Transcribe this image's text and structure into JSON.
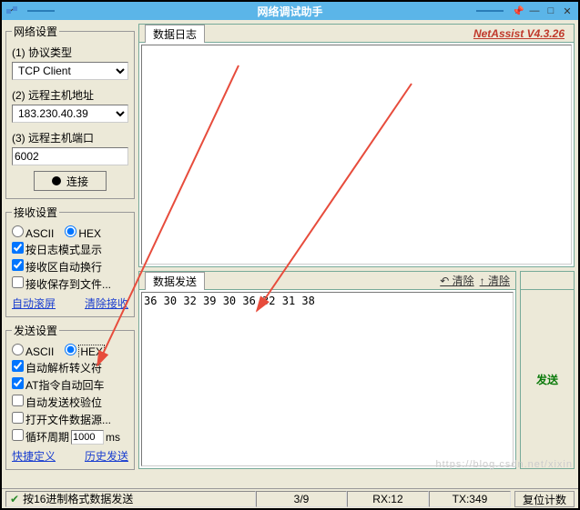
{
  "titlebar": {
    "title": "网络调试助手"
  },
  "version_label": "NetAssist V4.3.26",
  "network": {
    "legend": "网络设置",
    "protocol_label": "(1) 协议类型",
    "protocol_value": "TCP Client",
    "host_label": "(2) 远程主机地址",
    "host_value": "183.230.40.39",
    "port_label": "(3) 远程主机端口",
    "port_value": "6002",
    "connect_label": "连接"
  },
  "recv": {
    "legend": "接收设置",
    "ascii": "ASCII",
    "hex": "HEX",
    "opt1": "按日志模式显示",
    "opt2": "接收区自动换行",
    "opt3": "接收保存到文件...",
    "auto_scroll": "自动滚屏",
    "clear_recv": "清除接收"
  },
  "send": {
    "legend": "发送设置",
    "ascii": "ASCII",
    "hex": "HEX",
    "opt1": "自动解析转义符",
    "opt2": "AT指令自动回车",
    "opt3": "自动发送校验位",
    "opt4": "打开文件数据源...",
    "cycle_label": "循环周期",
    "cycle_value": "1000",
    "cycle_unit": "ms",
    "quick_def": "快捷定义",
    "history": "历史发送"
  },
  "log_panel": {
    "tab": "数据日志"
  },
  "send_panel": {
    "tab": "数据发送",
    "clear_undo": "↶ 清除",
    "clear": "↑ 清除",
    "send_btn": "发送",
    "content": "36 30 32 39 30 36 32 31 38"
  },
  "status": {
    "ready": "按16进制格式数据发送",
    "counter": "3/9",
    "rx": "RX:12",
    "tx": "TX:349",
    "reset": "复位计数"
  },
  "watermark": "https://blog.csdn.net/xixin"
}
